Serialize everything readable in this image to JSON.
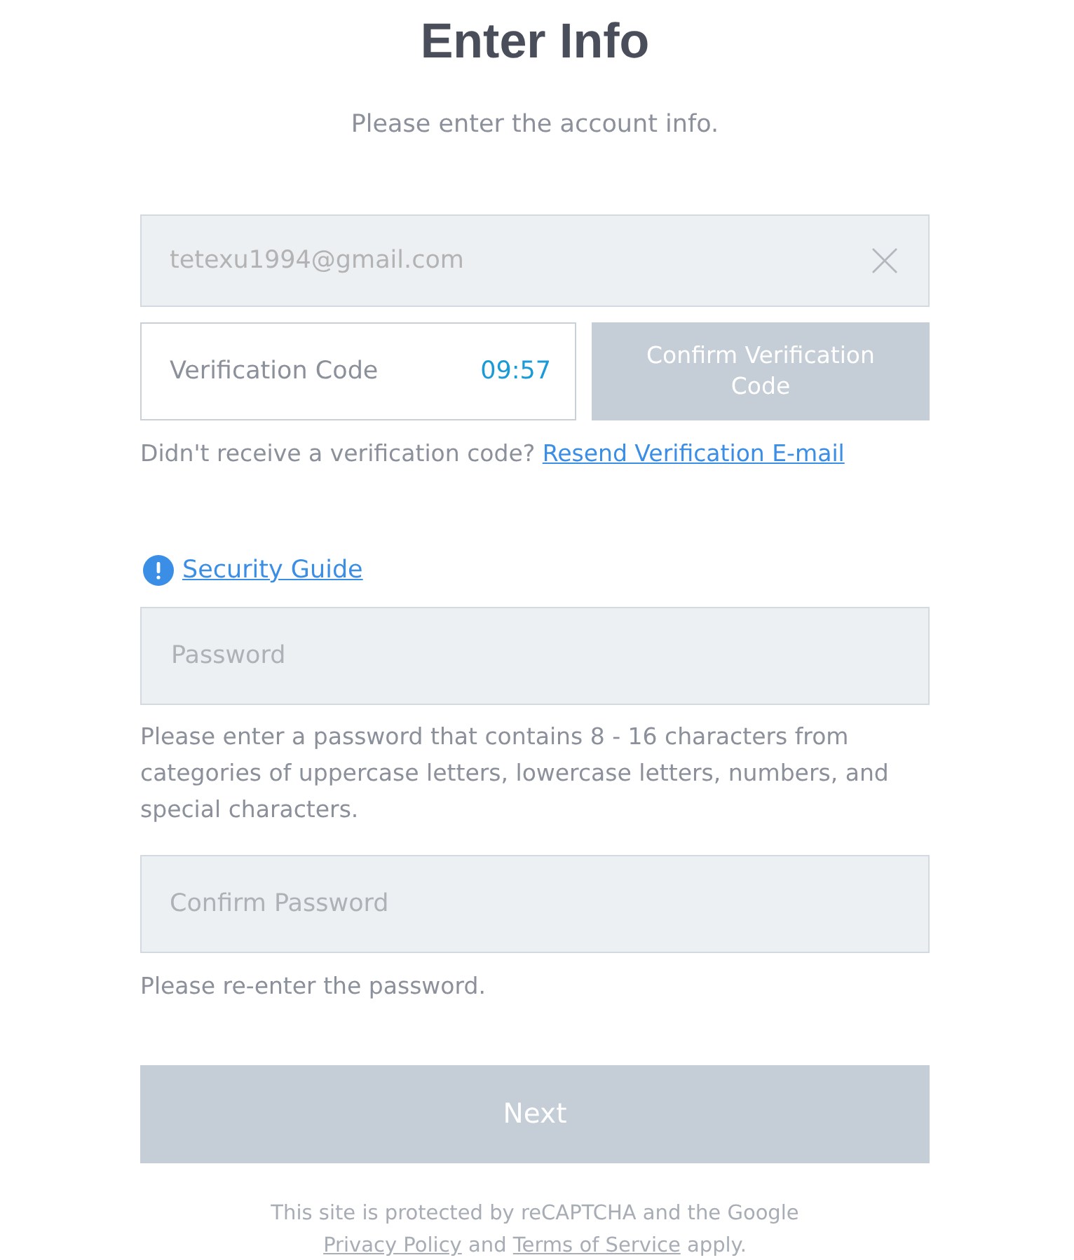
{
  "header": {
    "title": "Enter Info",
    "subtitle": "Please enter the account info."
  },
  "email_field": {
    "value": "tetexu1994@gmail.com",
    "disabled": true
  },
  "verification": {
    "placeholder": "Verification Code",
    "timer": "09:57",
    "confirm_button": {
      "label": "Confirm Verification Code",
      "disabled": true
    }
  },
  "resend": {
    "text": "Didn't receive a verification code?",
    "link": "Resend Verification E-mail"
  },
  "security_guide": {
    "link": "Security Guide"
  },
  "password_field": {
    "placeholder": "Password",
    "hint": "Please enter a password that contains 8 - 16 characters from categories of uppercase letters, lowercase letters, numbers, and special characters."
  },
  "confirm_password_field": {
    "placeholder": "Confirm Password",
    "hint": "Please re-enter the password."
  },
  "next_button": {
    "label": "Next",
    "disabled": true
  },
  "footer": {
    "line_1": "This site is protected by reCAPTCHA and the Google",
    "privacy_link": "Privacy Policy",
    "connector": "and",
    "terms_link": "Terms of Service",
    "ending": "apply."
  }
}
